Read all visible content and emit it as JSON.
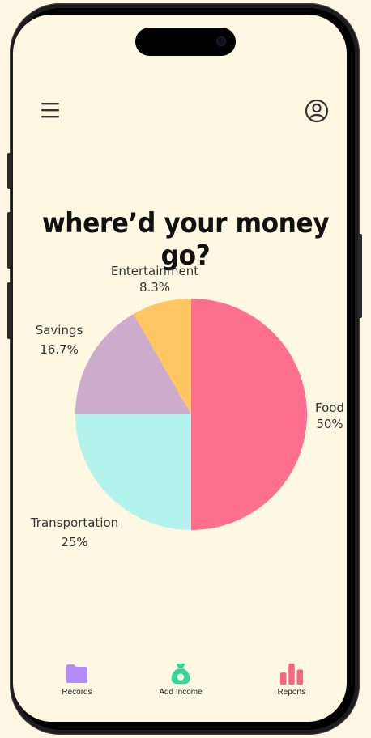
{
  "headline": "where’d your money go?",
  "chart_data": {
    "type": "pie",
    "slices": [
      {
        "name": "Food",
        "value": 50,
        "label": "50%",
        "color": "#ff6f8e"
      },
      {
        "name": "Transportation",
        "value": 25,
        "label": "25%",
        "color": "#b3f3ed"
      },
      {
        "name": "Savings",
        "value": 16.7,
        "label": "16.7%",
        "color": "#ccacca"
      },
      {
        "name": "Entertainment",
        "value": 8.3,
        "label": "8.3%",
        "color": "#ffc661"
      }
    ]
  },
  "tabs": {
    "records": "Records",
    "add_income": "Add Income",
    "reports": "Reports"
  },
  "icons": {
    "menu": "hamburger-menu-icon",
    "profile": "user-profile-icon",
    "records": "folder-icon",
    "add_income": "money-bag-icon",
    "reports": "bar-chart-icon"
  },
  "colors": {
    "background": "#fef7e2",
    "records_icon": "#b48cf7",
    "income_icon": "#36d39a",
    "reports_icon": "#f4687f"
  }
}
